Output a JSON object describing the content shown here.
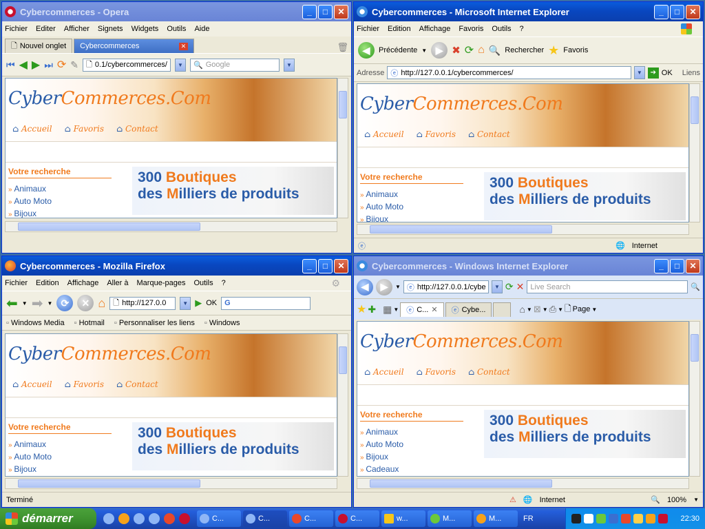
{
  "site": {
    "logo_part1": "Cyber",
    "logo_part2": "Commerces.Com",
    "nav": [
      "Accueil",
      "Favoris",
      "Contact"
    ],
    "sidebar_heading": "Votre recherche",
    "categories": [
      "Animaux",
      "Auto Moto",
      "Bijoux",
      "Cadeaux"
    ],
    "promo_line1_a": "300 ",
    "promo_line1_b": "Boutiques",
    "promo_line2_a": "des ",
    "promo_line2_b": "M",
    "promo_line2_c": "illiers de produits"
  },
  "opera": {
    "title": "Cybercommerces - Opera",
    "menu": [
      "Fichier",
      "Editer",
      "Afficher",
      "Signets",
      "Widgets",
      "Outils",
      "Aide"
    ],
    "new_tab": "Nouvel onglet",
    "tab_title": "Cybercommerces",
    "url": "0.1/cybercommerces/",
    "search_placeholder": "Google"
  },
  "ie6": {
    "title": "Cybercommerces - Microsoft Internet Explorer",
    "menu": [
      "Fichier",
      "Edition",
      "Affichage",
      "Favoris",
      "Outils",
      "?"
    ],
    "back": "Précédente",
    "search": "Rechercher",
    "favorites": "Favoris",
    "address_label": "Adresse",
    "url": "http://127.0.0.1/cybercommerces/",
    "go": "OK",
    "links": "Liens",
    "status_zone": "Internet"
  },
  "firefox": {
    "title": "Cybercommerces - Mozilla Firefox",
    "menu": [
      "Fichier",
      "Edition",
      "Affichage",
      "Aller à",
      "Marque-pages",
      "Outils",
      "?"
    ],
    "url": "http://127.0.0",
    "go": "OK",
    "bookmarks": [
      "Windows Media",
      "Hotmail",
      "Personnaliser les liens",
      "Windows"
    ],
    "status": "Terminé"
  },
  "ie7": {
    "title": "Cybercommerces - Windows Internet Explorer",
    "url": "http://127.0.0.1/cybe",
    "search_placeholder": "Live Search",
    "tab1": "C...",
    "tab2": "Cybe...",
    "page_menu": "Page",
    "status_zone": "Internet",
    "zoom": "100%"
  },
  "taskbar": {
    "start": "démarrer",
    "tasks": [
      "C...",
      "C...",
      "C...",
      "C...",
      "w...",
      "M...",
      "M..."
    ],
    "lang": "FR",
    "clock": "22:30"
  }
}
